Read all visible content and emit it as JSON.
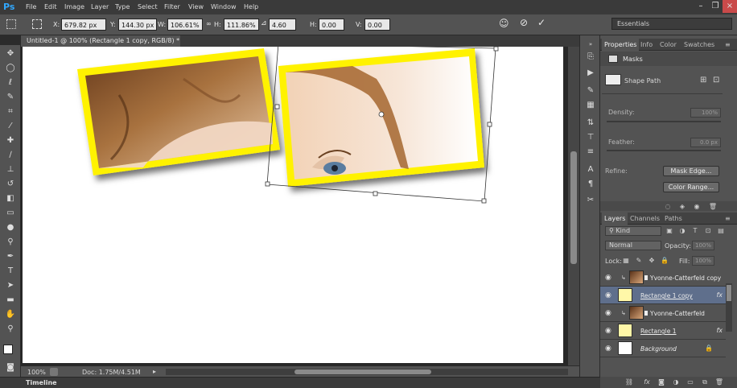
{
  "app": {
    "logo": "Ps"
  },
  "menu": [
    "File",
    "Edit",
    "Image",
    "Layer",
    "Type",
    "Select",
    "Filter",
    "View",
    "Window",
    "Help"
  ],
  "options": {
    "x_label": "X:",
    "x_value": "679.82 px",
    "y_label": "Y:",
    "y_value": "144.30 px",
    "w_label": "W:",
    "w_value": "106.61%",
    "h_label": "H:",
    "h_value": "111.86%",
    "angle_value": "4.60",
    "hskew_label": "H:",
    "hskew_value": "0.00",
    "vskew_label": "V:",
    "vskew_value": "0.00",
    "workspace": "Essentials"
  },
  "document": {
    "tab_title": "Untitled-1 @ 100% (Rectangle 1 copy, RGB/8) *",
    "close_glyph": "×"
  },
  "status": {
    "zoom": "100%",
    "doc": "Doc: 1.75M/4.51M"
  },
  "timeline": {
    "label": "Timeline"
  },
  "properties_panel": {
    "tabs": [
      "Properties",
      "Info",
      "Color",
      "Swatches"
    ],
    "section": "Masks",
    "shape_path": "Shape Path",
    "density_label": "Density:",
    "density_value": "100%",
    "feather_label": "Feather:",
    "feather_value": "0.0 px",
    "refine_label": "Refine:",
    "mask_edge_button": "Mask Edge...",
    "color_range_button": "Color Range..."
  },
  "layers_panel": {
    "tabs": [
      "Layers",
      "Channels",
      "Paths"
    ],
    "kind_filter": "Kind",
    "blend_mode": "Normal",
    "opacity_label": "Opacity:",
    "opacity_value": "100%",
    "lock_label": "Lock:",
    "fill_label": "Fill:",
    "fill_value": "100%",
    "fx_glyph": "fx",
    "layers": [
      {
        "name": "Yvonne-Catterfeld copy",
        "clipped": true,
        "selected": false,
        "fx": false,
        "underline": false
      },
      {
        "name": "Rectangle 1 copy",
        "clipped": false,
        "selected": true,
        "fx": true,
        "underline": true
      },
      {
        "name": "Yvonne-Catterfeld",
        "clipped": true,
        "selected": false,
        "fx": false,
        "underline": false
      },
      {
        "name": "Rectangle 1",
        "clipped": false,
        "selected": false,
        "fx": true,
        "underline": true
      },
      {
        "name": "Background",
        "clipped": false,
        "selected": false,
        "fx": false,
        "underline": false,
        "locked": true
      }
    ]
  },
  "colors": {
    "frame_yellow": "#fff200",
    "panel_gray": "#535353",
    "selected_layer": "#5f6f8c",
    "ps_blue": "#31a8ff"
  }
}
